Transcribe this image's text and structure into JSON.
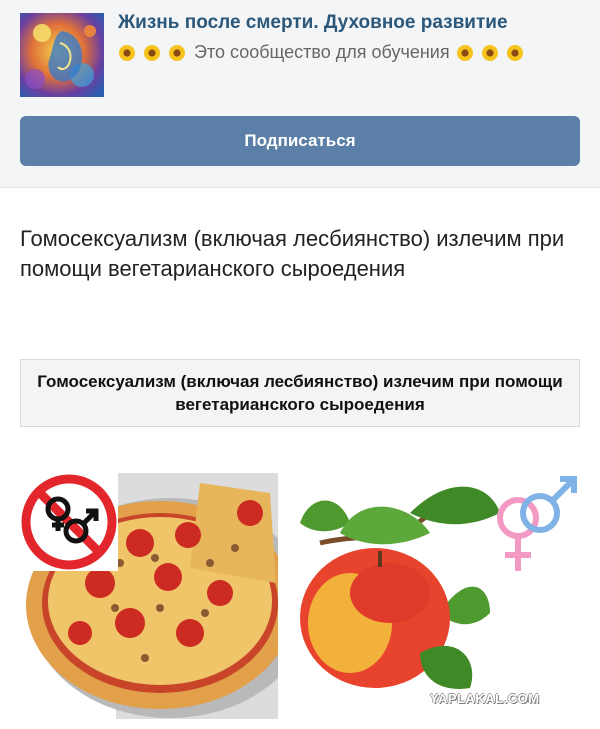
{
  "community": {
    "title": "Жизнь после смерти. Духовное развитие",
    "description": "Это сообщество для обучения",
    "subscribe_label": "Подписаться"
  },
  "post": {
    "text": "Гомосексуализм (включая лесбиянство) излечим при помощи вегетарианского сыроедения",
    "quote": "Гомосексуализм (включая лесбиянство) излечим при помощи вегетарианского сыроедения"
  },
  "images": {
    "left": "pizza-with-prohibited-male-symbols",
    "right": "apple-with-female-male-symbol"
  },
  "watermark": "YAPLAKAL.COM",
  "colors": {
    "title": "#2b587a",
    "button": "#5b7fa6",
    "header_bg": "#f4f5f7",
    "prohibit_red": "#e3262b",
    "gender_pink": "#f29ac4",
    "gender_blue": "#7fb2e5"
  }
}
